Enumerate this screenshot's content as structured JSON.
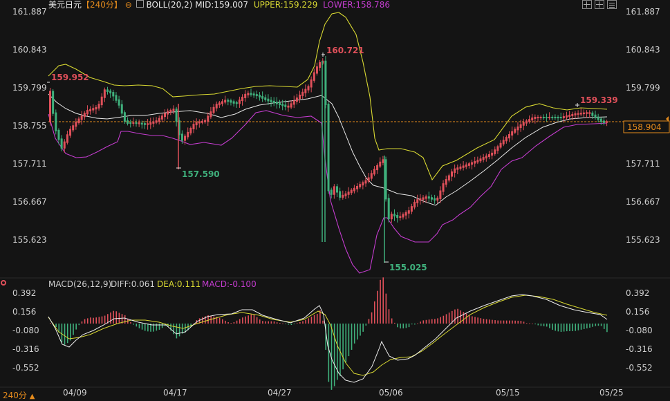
{
  "header": {
    "symbol": "美元日元",
    "period_tag": "【240分】",
    "boll_label": "BOLL(20,2)",
    "mid_label": "MID:159.007",
    "upper_label": "UPPER:159.229",
    "lower_label": "LOWER:158.786"
  },
  "macd_header": {
    "label": "MACD(26,12,9)",
    "diff_label": "DIFF:0.061",
    "dea_label": "DEA:0.111",
    "macd_label": "MACD:-0.100"
  },
  "footer": {
    "period_select": "240分",
    "arrow": "▲"
  },
  "current_price_tag": "158.904",
  "colors": {
    "background": "#141414",
    "up": "#e0505a",
    "down": "#3fb07c",
    "mid": "#e8e8e8",
    "upper": "#d8d832",
    "lower": "#c43ccf",
    "current": "#e38a1c"
  },
  "chart_data": [
    {
      "type": "candlestick",
      "title": "美元日元 240分 BOLL(20,2)",
      "y_axis_ticks": [
        "161.887",
        "160.843",
        "159.799",
        "158.755",
        "157.711",
        "156.667",
        "155.623"
      ],
      "ylim": [
        155.2,
        161.887
      ],
      "x_tick_labels": [
        "04/09",
        "04/17",
        "04/27",
        "05/06",
        "05/15",
        "05/25"
      ],
      "annotations": [
        "159.952",
        "157.590",
        "160.721",
        "155.025",
        "159.339"
      ],
      "current_price": 158.904,
      "overlays": [
        "BOLL MID",
        "BOLL UPPER",
        "BOLL LOWER"
      ]
    },
    {
      "type": "bar",
      "title": "MACD(26,12,9)",
      "y_axis_ticks": [
        "0.392",
        "0.156",
        "-0.080",
        "-0.316",
        "-0.552"
      ],
      "ylim": [
        -0.7,
        0.45
      ],
      "series": [
        {
          "name": "DIFF",
          "last": 0.061
        },
        {
          "name": "DEA",
          "last": 0.111
        },
        {
          "name": "MACD",
          "last": -0.1
        }
      ]
    }
  ]
}
